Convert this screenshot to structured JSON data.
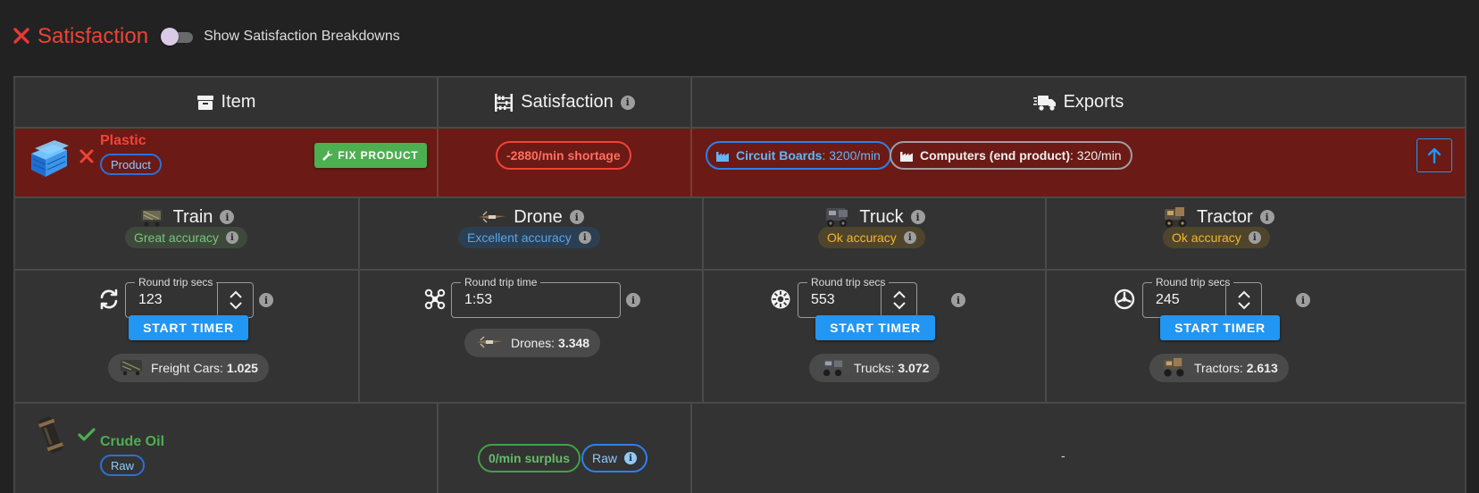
{
  "header": {
    "title": "Satisfaction",
    "toggle_label": "Show Satisfaction Breakdowns",
    "toggle_on": false
  },
  "columns": {
    "item": "Item",
    "satisfaction": "Satisfaction",
    "exports": "Exports"
  },
  "rows": {
    "plastic": {
      "name": "Plastic",
      "tag": "Product",
      "fix_label": "FIX PRODUCT",
      "satisfaction": "-2880/min shortage",
      "exports": [
        {
          "name": "Circuit Boards",
          "rate": "3200/min"
        },
        {
          "name": "Computers (end product)",
          "rate": "320/min"
        }
      ]
    },
    "crude_oil": {
      "name": "Crude Oil",
      "tag": "Raw",
      "satisfaction": "0/min surplus",
      "raw_label": "Raw",
      "exports": "-"
    }
  },
  "vehicles": [
    {
      "name": "Train",
      "accuracy": "Great accuracy",
      "field_label": "Round trip secs",
      "field_value": "123",
      "has_stepper": true,
      "start_label": "START TIMER",
      "count_label": "Freight Cars:",
      "count_value": "1.025"
    },
    {
      "name": "Drone",
      "accuracy": "Excellent accuracy",
      "field_label": "Round trip time",
      "field_value": "1:53",
      "has_stepper": false,
      "start_label": "",
      "count_label": "Drones:",
      "count_value": "3.348"
    },
    {
      "name": "Truck",
      "accuracy": "Ok accuracy",
      "field_label": "Round trip secs",
      "field_value": "553",
      "has_stepper": true,
      "start_label": "START TIMER",
      "count_label": "Trucks:",
      "count_value": "3.072"
    },
    {
      "name": "Tractor",
      "accuracy": "Ok accuracy",
      "field_label": "Round trip secs",
      "field_value": "245",
      "has_stepper": true,
      "start_label": "START TIMER",
      "count_label": "Tractors:",
      "count_value": "2.613"
    }
  ],
  "colors": {
    "danger": "#f44336",
    "success": "#4caf50",
    "primary": "#2196f3",
    "warning": "#ffc107",
    "row_shortage_bg": "#6b1a16"
  },
  "icons": [
    "close-icon",
    "box-icon",
    "abacus-icon",
    "truck-fast-icon",
    "info-icon",
    "wrench-icon",
    "industry-icon",
    "arrow-up-icon",
    "sync-icon",
    "drone-icon",
    "gear-icon",
    "steering-wheel-icon",
    "chevron-up-icon",
    "chevron-down-icon",
    "check-icon"
  ]
}
